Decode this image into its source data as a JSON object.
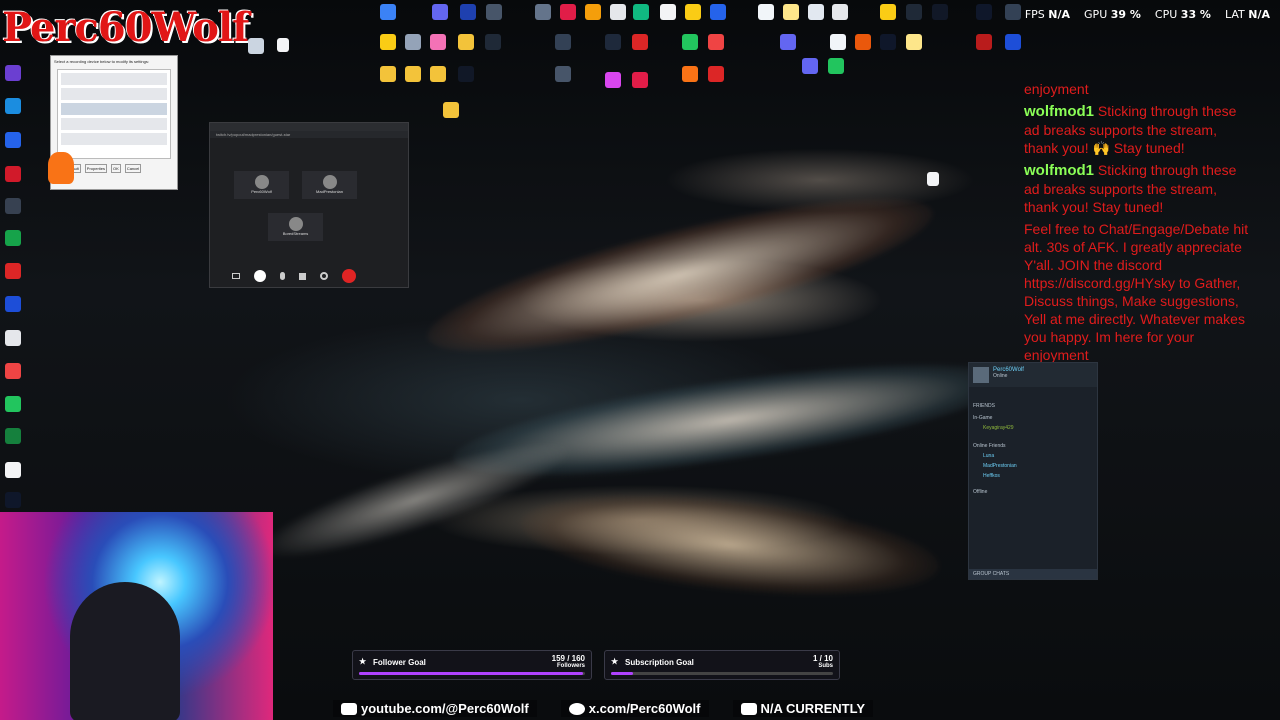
{
  "overlay": {
    "logo_text": "Perc60Wolf",
    "fps_label": "FPS",
    "fps_value": "N/A",
    "gpu_label": "GPU",
    "gpu_value": "39 %",
    "cpu_label": "CPU",
    "cpu_value": "33 %",
    "lat_label": "LAT",
    "lat_value": "N/A"
  },
  "chat": {
    "messages": [
      {
        "user": "",
        "text": "enjoyment"
      },
      {
        "user": "wolfmod1",
        "text": "Sticking through these ad breaks supports the stream, thank you! 🙌 Stay tuned!"
      },
      {
        "user": "wolfmod1",
        "text": "Sticking through these ad breaks supports the stream, thank you! Stay tuned!"
      },
      {
        "user": "",
        "text": "Feel free to Chat/Engage/Debate hit alt. 30s of AFK. I greatly appreciate Y'all. JOIN the discord https://discord.gg/HYsky to Gather, Discuss things, Make suggestions, Yell at me directly. Whatever makes you happy. Im here for your enjoyment"
      }
    ]
  },
  "steam": {
    "username": "Perc60Wolf",
    "status": "Online",
    "friends_header": "FRIENDS",
    "in_game_label": "In-Game",
    "online_label": "Online Friends",
    "offline_label": "Offline",
    "group_chats": "GROUP CHATS",
    "friends": [
      "Keyagiray429",
      "Luna",
      "MadPrestonian",
      "Heffkos"
    ]
  },
  "call_window": {
    "url": "twitch.tv/popout/madprestonian/guest-star",
    "participants": [
      "Perc60Wolf",
      "MadPrestonian",
      "BoredStreams"
    ]
  },
  "settings_window": {
    "title": "Select a recording device below to modify its settings:",
    "buttons": [
      "Set Default",
      "Properties",
      "OK",
      "Cancel",
      "Apply"
    ]
  },
  "goals": {
    "follower": {
      "label": "Follower Goal",
      "count": "159 / 160",
      "unit": "Followers",
      "progress": 0.99
    },
    "subscription": {
      "label": "Subscription Goal",
      "count": "1 / 10",
      "unit": "Subs",
      "progress": 0.1
    }
  },
  "socials": {
    "youtube": "youtube.com/@Perc60Wolf",
    "x": "x.com/Perc60Wolf",
    "facebook": "N/A CURRENTLY"
  },
  "desktop_icons": [
    "Recycle Bin",
    "This PC",
    "OBS Studio",
    "Steam",
    "Discord",
    "Google Chrome",
    "Firefox",
    "GIMP",
    "Audacity",
    "VLC",
    "Epic Games",
    "Xbox",
    "Minecraft",
    "Rockstar Games",
    "Battle.net",
    "Spotify"
  ]
}
